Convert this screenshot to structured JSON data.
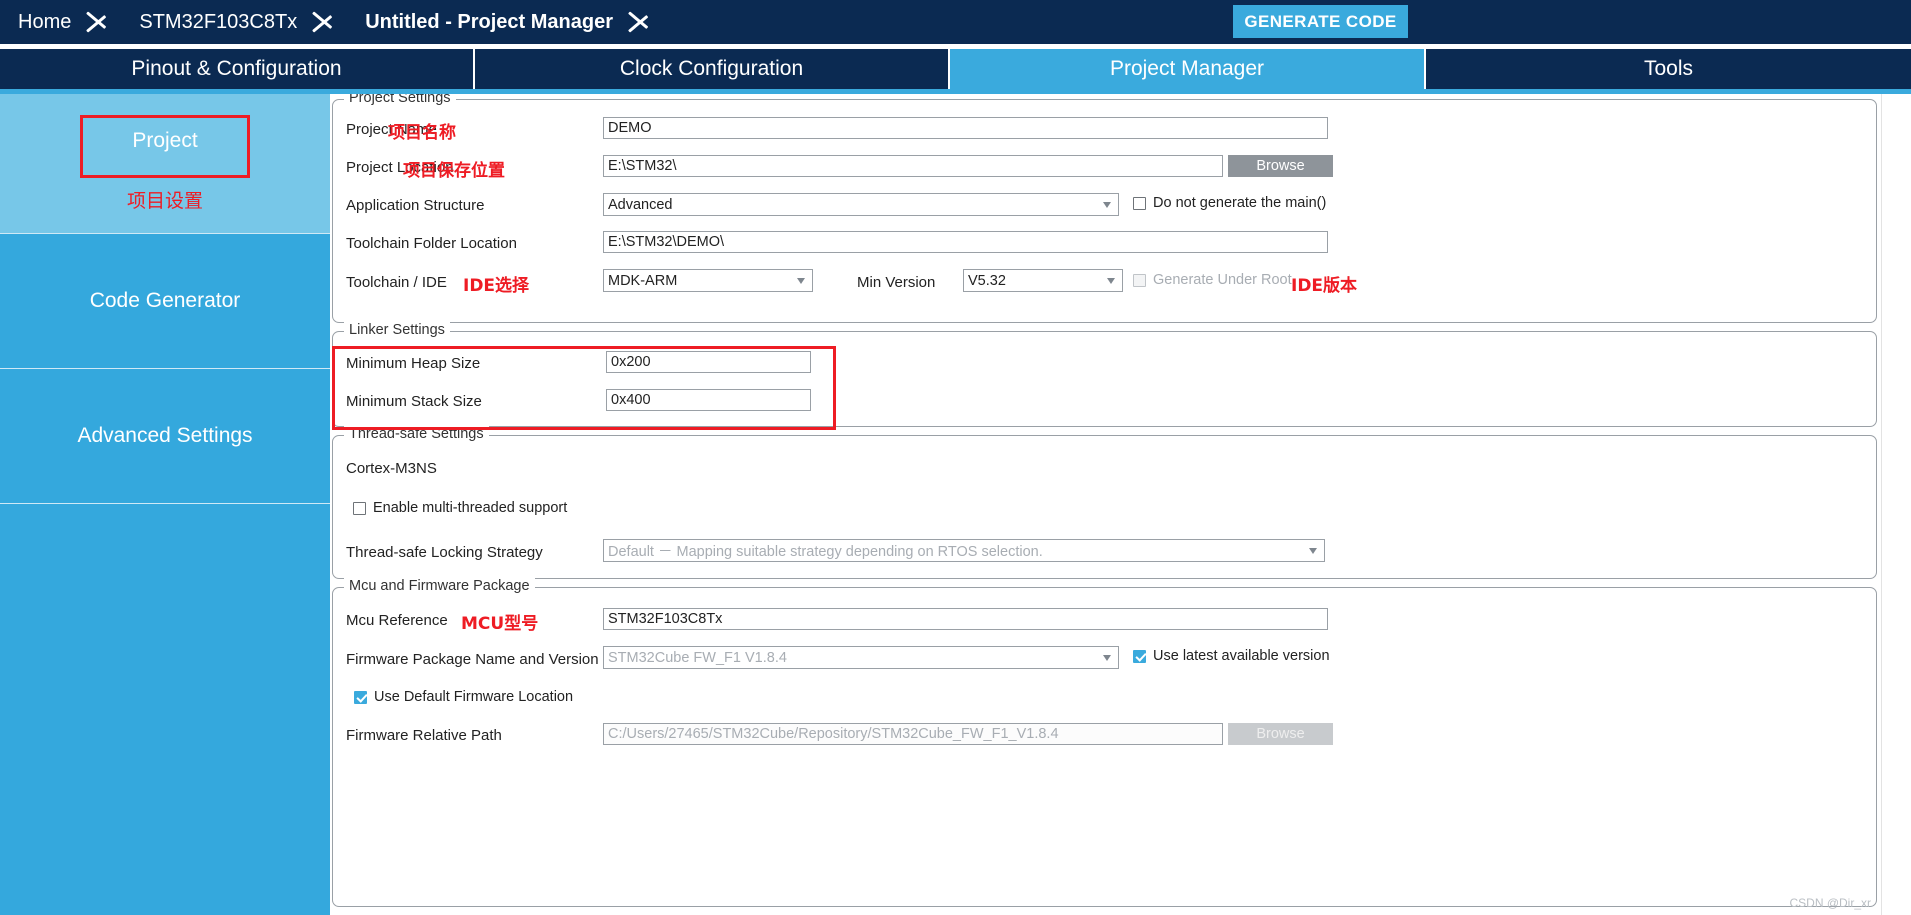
{
  "breadcrumb": {
    "items": [
      {
        "label": "Home",
        "bold": false
      },
      {
        "label": "STM32F103C8Tx",
        "bold": false
      },
      {
        "label": "Untitled - Project Manager",
        "bold": true
      }
    ]
  },
  "header": {
    "generate_code_label": "GENERATE CODE",
    "accent_color": "#3aaadd",
    "navy_color": "#0b2a52"
  },
  "tabs": [
    {
      "label": "Pinout & Configuration",
      "active": false
    },
    {
      "label": "Clock Configuration",
      "active": false
    },
    {
      "label": "Project Manager",
      "active": true
    },
    {
      "label": "Tools",
      "active": false
    }
  ],
  "sidebar": {
    "items": [
      {
        "label": "Project",
        "selected": true,
        "annotation": "项目设置"
      },
      {
        "label": "Code Generator",
        "selected": false
      },
      {
        "label": "Advanced Settings",
        "selected": false
      }
    ]
  },
  "project_settings": {
    "group_title": "Project Settings",
    "project_name": {
      "label": "Project Name",
      "value": "DEMO",
      "annotation": "项目名称"
    },
    "project_location": {
      "label": "Project Location",
      "value": "E:\\STM32\\",
      "annotation": "项目保存位置",
      "browse_label": "Browse"
    },
    "application_structure": {
      "label": "Application Structure",
      "value": "Advanced"
    },
    "do_not_generate_main": {
      "label": "Do not generate the main()",
      "checked": false
    },
    "toolchain_folder_location": {
      "label": "Toolchain Folder Location",
      "value": "E:\\STM32\\DEMO\\"
    },
    "toolchain_ide": {
      "label": "Toolchain / IDE",
      "value": "MDK-ARM",
      "annotation": "IDE选择"
    },
    "min_version": {
      "label": "Min Version",
      "value": "V5.32",
      "annotation": "IDE版本"
    },
    "generate_under_root": {
      "label": "Generate Under Root",
      "checked": false,
      "disabled": true
    }
  },
  "linker_settings": {
    "group_title": "Linker Settings",
    "min_heap_size": {
      "label": "Minimum Heap Size",
      "value": "0x200"
    },
    "min_stack_size": {
      "label": "Minimum Stack Size",
      "value": "0x400"
    },
    "highlight_color": "#ee1c24"
  },
  "thread_safe_settings": {
    "group_title": "Thread-safe Settings",
    "core_label": "Cortex-M3NS",
    "enable_multi_threaded": {
      "label": "Enable multi-threaded support",
      "checked": false
    },
    "locking_strategy": {
      "label": "Thread-safe Locking Strategy",
      "value": "Default － Mapping suitable strategy depending on RTOS selection."
    }
  },
  "mcu_firmware_package": {
    "group_title": "Mcu and Firmware Package",
    "mcu_reference": {
      "label": "Mcu Reference",
      "value": "STM32F103C8Tx",
      "annotation": "MCU型号"
    },
    "firmware_package": {
      "label": "Firmware Package Name and Version",
      "value": "STM32Cube FW_F1 V1.8.4"
    },
    "use_latest_version": {
      "label": "Use latest available version",
      "checked": true
    },
    "use_default_firmware_location": {
      "label": "Use Default Firmware Location",
      "checked": true
    },
    "firmware_relative_path": {
      "label": "Firmware Relative Path",
      "value": "C:/Users/27465/STM32Cube/Repository/STM32Cube_FW_F1_V1.8.4",
      "browse_label": "Browse"
    }
  },
  "watermark": {
    "text": "CSDN @Dir_xr"
  }
}
